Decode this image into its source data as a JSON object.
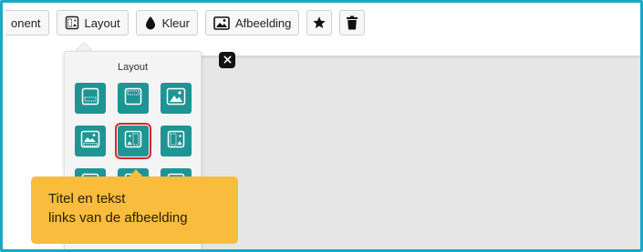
{
  "toolbar": {
    "component_label": "onent",
    "layout_label": "Layout",
    "color_label": "Kleur",
    "image_label": "Afbeelding"
  },
  "layout_panel": {
    "title": "Layout",
    "tiles": [
      {
        "name": "layout-tile-title-bottom",
        "icon": "title-bottom-icon"
      },
      {
        "name": "layout-tile-title-top",
        "icon": "title-top-icon"
      },
      {
        "name": "layout-tile-image-only",
        "icon": "image-icon"
      },
      {
        "name": "layout-tile-image-caption",
        "icon": "image-caption-icon"
      },
      {
        "name": "layout-tile-text-left-of-image",
        "icon": "text-left-image-icon",
        "selected": true
      },
      {
        "name": "layout-tile-text-right-of-image",
        "icon": "text-right-image-icon"
      },
      {
        "name": "layout-tile-row3-a",
        "icon": "layout-icon"
      },
      {
        "name": "layout-tile-row3-b",
        "icon": "layout-icon"
      },
      {
        "name": "layout-tile-row3-c",
        "icon": "layout-icon"
      }
    ]
  },
  "tooltip": {
    "line1": "Titel en tekst",
    "line2": "links van de afbeelding"
  },
  "colors": {
    "accent": "#17a9c7",
    "tile": "#1f9494",
    "selected_outline": "#d9262e",
    "tooltip_bg": "#f9bc3c"
  }
}
